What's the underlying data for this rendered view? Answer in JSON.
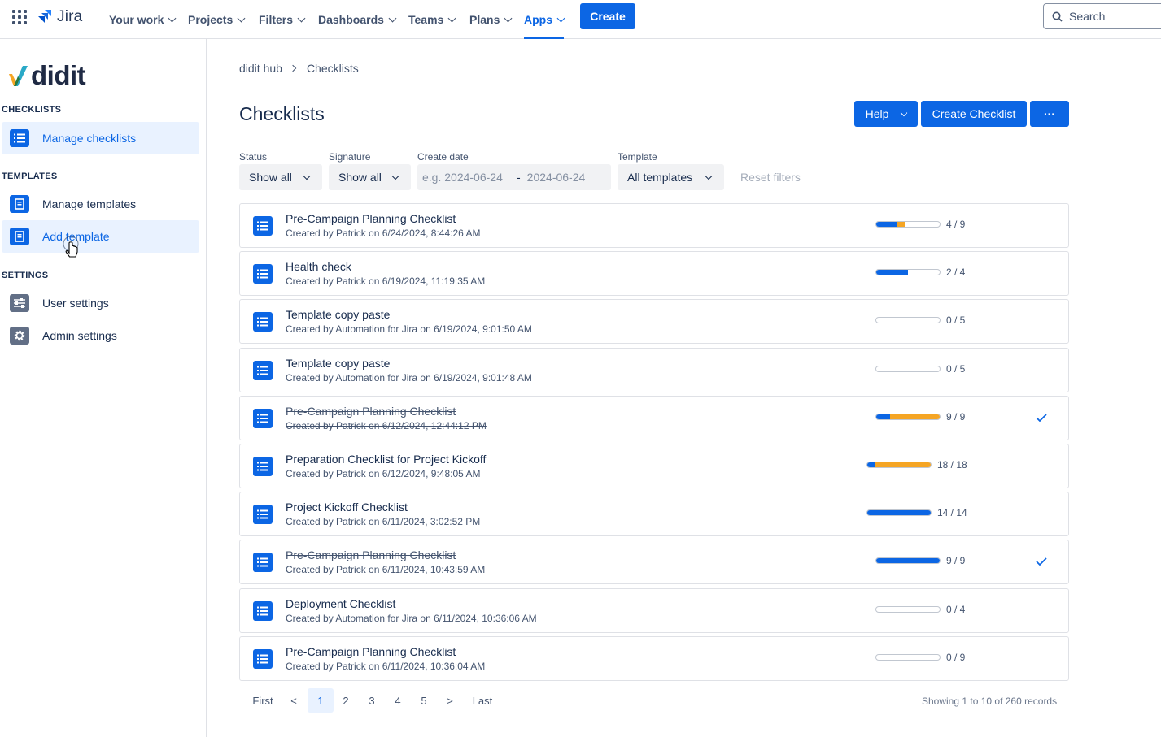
{
  "topnav": {
    "product": "Jira",
    "items": [
      {
        "label": "Your work"
      },
      {
        "label": "Projects"
      },
      {
        "label": "Filters"
      },
      {
        "label": "Dashboards"
      },
      {
        "label": "Teams"
      },
      {
        "label": "Plans"
      },
      {
        "label": "Apps",
        "active": true
      }
    ],
    "create_label": "Create",
    "search_placeholder": "Search"
  },
  "sidebar": {
    "brand": "didit",
    "sections": [
      {
        "title": "CHECKLISTS",
        "items": [
          {
            "label": "Manage checklists",
            "icon": "list-icon",
            "selected": true
          }
        ]
      },
      {
        "title": "TEMPLATES",
        "items": [
          {
            "label": "Manage templates",
            "icon": "document-icon"
          },
          {
            "label": "Add template",
            "icon": "document-icon",
            "hovered": true
          }
        ]
      },
      {
        "title": "SETTINGS",
        "items": [
          {
            "label": "User settings",
            "icon": "sliders-icon"
          },
          {
            "label": "Admin settings",
            "icon": "gear-icon"
          }
        ]
      }
    ]
  },
  "main": {
    "breadcrumb": [
      "didit hub",
      "Checklists"
    ],
    "title": "Checklists",
    "actions": {
      "help": "Help",
      "create": "Create Checklist",
      "more": "···"
    },
    "filters": {
      "status": {
        "label": "Status",
        "value": "Show all"
      },
      "signature": {
        "label": "Signature",
        "value": "Show all"
      },
      "create_date": {
        "label": "Create date",
        "from_placeholder": "e.g. 2024-06-24",
        "separator": "-",
        "to_placeholder": "2024-06-24"
      },
      "template": {
        "label": "Template",
        "value": "All templates"
      },
      "reset": "Reset filters"
    },
    "checklists": [
      {
        "title": "Pre-Campaign Planning Checklist",
        "subtitle": "Created by Patrick on 6/24/2024, 8:44:26 AM",
        "blue": 3,
        "orange": 1,
        "total": 9,
        "count": "4 / 9",
        "done": false
      },
      {
        "title": "Health check",
        "subtitle": "Created by Patrick on 6/19/2024, 11:19:35 AM",
        "blue": 2,
        "orange": 0,
        "total": 4,
        "count": "2 / 4",
        "done": false
      },
      {
        "title": "Template copy paste",
        "subtitle": "Created by Automation for Jira on 6/19/2024, 9:01:50 AM",
        "blue": 0,
        "orange": 0,
        "total": 5,
        "count": "0 / 5",
        "done": false
      },
      {
        "title": "Template copy paste",
        "subtitle": "Created by Automation for Jira on 6/19/2024, 9:01:48 AM",
        "blue": 0,
        "orange": 0,
        "total": 5,
        "count": "0 / 5",
        "done": false
      },
      {
        "title": "Pre-Campaign Planning Checklist",
        "subtitle": "Created by Patrick on 6/12/2024, 12:44:12 PM",
        "blue": 2,
        "orange": 7,
        "total": 9,
        "count": "9 / 9",
        "done": true
      },
      {
        "title": "Preparation Checklist for Project Kickoff",
        "subtitle": "Created by Patrick on 6/12/2024, 9:48:05 AM",
        "blue": 2,
        "orange": 16,
        "total": 18,
        "count": "18 / 18",
        "done": false
      },
      {
        "title": "Project Kickoff Checklist",
        "subtitle": "Created by Patrick on 6/11/2024, 3:02:52 PM",
        "blue": 14,
        "orange": 0,
        "total": 14,
        "count": "14 / 14",
        "done": false
      },
      {
        "title": "Pre-Campaign Planning Checklist",
        "subtitle": "Created by Patrick on 6/11/2024, 10:43:59 AM",
        "blue": 9,
        "orange": 0,
        "total": 9,
        "count": "9 / 9",
        "done": true
      },
      {
        "title": "Deployment Checklist",
        "subtitle": "Created by Automation for Jira on 6/11/2024, 10:36:06 AM",
        "blue": 0,
        "orange": 0,
        "total": 4,
        "count": "0 / 4",
        "done": false
      },
      {
        "title": "Pre-Campaign Planning Checklist",
        "subtitle": "Created by Patrick on 6/11/2024, 10:36:04 AM",
        "blue": 0,
        "orange": 0,
        "total": 9,
        "count": "0 / 9",
        "done": false
      }
    ],
    "pagination": {
      "items": [
        "First",
        "<",
        "1",
        "2",
        "3",
        "4",
        "5",
        ">",
        "Last"
      ],
      "current": "1"
    },
    "records": "Showing 1 to 10 of 260 records"
  },
  "colors": {
    "accent": "#0C66E4",
    "progress_blue": "#0C66E4",
    "progress_orange": "#F5A524"
  }
}
